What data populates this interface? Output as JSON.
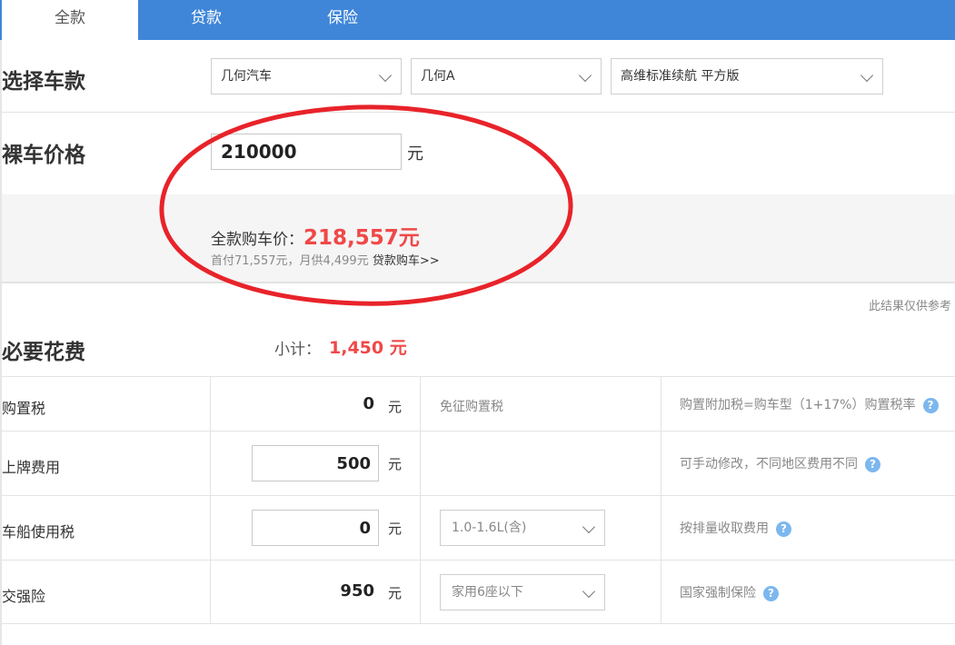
{
  "tabs": [
    {
      "label": "全款",
      "active": true
    },
    {
      "label": "贷款",
      "active": false
    },
    {
      "label": "保险",
      "active": false
    }
  ],
  "select_car": {
    "title": "选择车款",
    "brand": "几何汽车",
    "model": "几何A",
    "trim": "高维标准续航 平方版"
  },
  "bare_price": {
    "title": "裸车价格",
    "value": "210000",
    "unit": "元"
  },
  "summary": {
    "total_label": "全款购车价：",
    "total_value": "218,557元",
    "sub_info": "首付71,557元，月供4,499元",
    "loan_link": "贷款购车>>"
  },
  "note": "此结果仅供参考",
  "required_fees": {
    "title": "必要花费",
    "subtotal_label": "小计：",
    "subtotal_value": "1,450 元",
    "rows": [
      {
        "label": "购置税",
        "value": "0",
        "unit": "元",
        "desc": "免征购置税",
        "tip": "购置附加税=购车型（1+17%）购置税率"
      },
      {
        "label": "上牌费用",
        "value": "500",
        "unit": "元",
        "desc": "",
        "tip": "可手动修改，不同地区费用不同"
      },
      {
        "label": "车船使用税",
        "value": "0",
        "unit": "元",
        "select": "1.0-1.6L(含)",
        "tip": "按排量收取费用"
      },
      {
        "label": "交强险",
        "value": "950",
        "unit": "元",
        "select": "家用6座以下",
        "tip": "国家强制保险"
      }
    ]
  },
  "icons": {
    "help": "?"
  },
  "colors": {
    "tab_bar": "#3f86d8",
    "accent_red": "#f04848",
    "annotation": "#e8232a",
    "help_icon": "#7cb7ee"
  }
}
